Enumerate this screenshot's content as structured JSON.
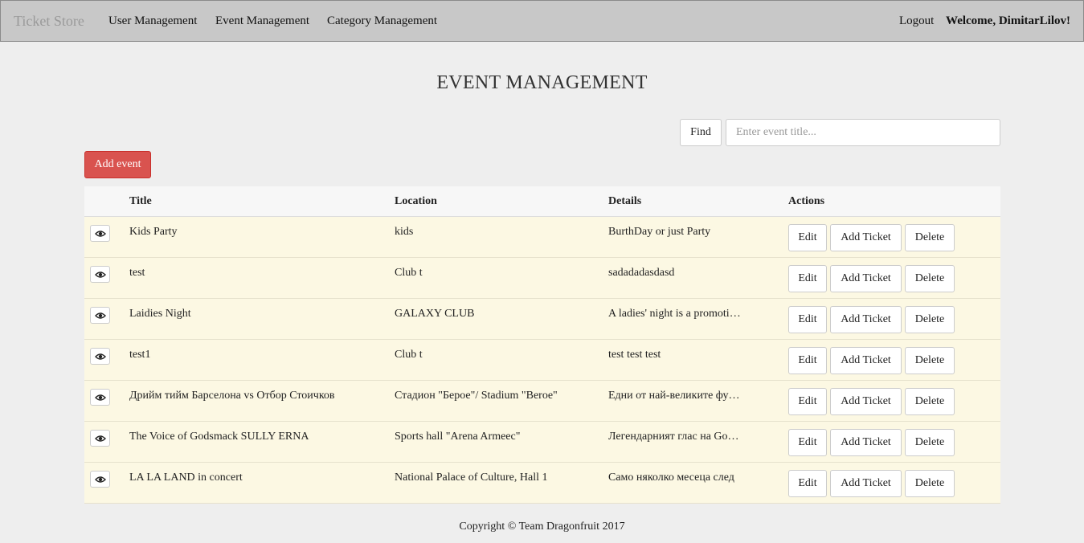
{
  "navbar": {
    "brand": "Ticket Store",
    "links": [
      "User Management",
      "Event Management",
      "Category Management"
    ],
    "logout": "Logout",
    "welcome": "Welcome, DimitarLilov!"
  },
  "page": {
    "title": "EVENT MANAGEMENT"
  },
  "search": {
    "button": "Find",
    "placeholder": "Enter event title..."
  },
  "add_button": "Add event",
  "table": {
    "headers": [
      "Title",
      "Location",
      "Details",
      "Actions"
    ],
    "rows": [
      {
        "title": "Kids Party",
        "location": "kids",
        "details": "BurthDay or just Party"
      },
      {
        "title": "test",
        "location": "Club t",
        "details": "sadadadasdasd"
      },
      {
        "title": "Laidies Night",
        "location": "GALAXY CLUB",
        "details": "A ladies' night is a promotional event"
      },
      {
        "title": "test1",
        "location": "Club t",
        "details": "test test test"
      },
      {
        "title": "Дрийм тийм Барселона vs Отбор Стоичков",
        "location": "Стадион \"Берое\"/ Stadium \"Beroe\"",
        "details": "Едни от най-великите футболисти"
      },
      {
        "title": "The Voice of Godsmack SULLY ERNA",
        "location": "Sports hall \"Arena Armeec\"",
        "details": "Легендарният глас на Godsmack"
      },
      {
        "title": "LA LA LAND in concert",
        "location": "National Palace of Culture, Hall 1",
        "details": "Само няколко месеца след"
      }
    ],
    "actions": {
      "edit": "Edit",
      "add_ticket": "Add Ticket",
      "delete": "Delete"
    },
    "view_icon": "eye-icon"
  },
  "footer": "Copyright © Team Dragonfruit 2017",
  "colors": {
    "navbar": "#c8c8c8",
    "row_bg": "#fcf8e3",
    "add_button": "#d9534f"
  }
}
